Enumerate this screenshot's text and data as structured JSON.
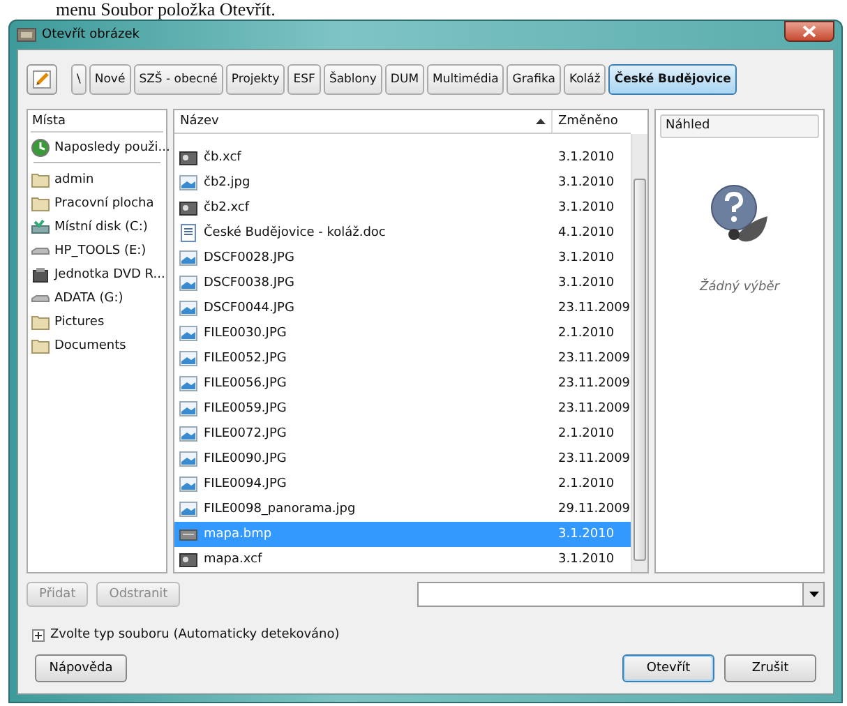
{
  "caption": "menu Soubor položka Otevřít.",
  "window": {
    "title": "Otevřít obrázek"
  },
  "path_bar": [
    {
      "label": "\\",
      "selected": false
    },
    {
      "label": "Nové",
      "selected": false
    },
    {
      "label": "SZŠ - obecné",
      "selected": false
    },
    {
      "label": "Projekty",
      "selected": false
    },
    {
      "label": "ESF",
      "selected": false
    },
    {
      "label": "Šablony",
      "selected": false
    },
    {
      "label": "DUM",
      "selected": false
    },
    {
      "label": "Multimédia",
      "selected": false
    },
    {
      "label": "Grafika",
      "selected": false
    },
    {
      "label": "Koláž",
      "selected": false
    },
    {
      "label": "České Budějovice",
      "selected": true
    }
  ],
  "places": {
    "header": "Místa",
    "items": [
      {
        "label": "Naposledy použi...",
        "kind": "recent",
        "selected": false
      },
      {
        "label": "admin",
        "kind": "folder",
        "selected": false
      },
      {
        "label": "Pracovní plocha",
        "kind": "folder",
        "selected": false
      },
      {
        "label": "Místní disk (C:)",
        "kind": "disk",
        "selected": false
      },
      {
        "label": "HP_TOOLS (E:)",
        "kind": "drive",
        "selected": false
      },
      {
        "label": "Jednotka DVD R...",
        "kind": "dvd",
        "selected": false
      },
      {
        "label": "ADATA (G:)",
        "kind": "drive",
        "selected": false
      },
      {
        "label": "Pictures",
        "kind": "folder",
        "selected": false
      },
      {
        "label": "Documents",
        "kind": "folder",
        "selected": false
      }
    ]
  },
  "files": {
    "columns": [
      "Název",
      "Změněno"
    ],
    "rows": [
      {
        "name": "čb.xcf",
        "modified": "3.1.2010",
        "kind": "xcf",
        "selected": false
      },
      {
        "name": "čb2.jpg",
        "modified": "3.1.2010",
        "kind": "image",
        "selected": false
      },
      {
        "name": "čb2.xcf",
        "modified": "3.1.2010",
        "kind": "xcf",
        "selected": false
      },
      {
        "name": "České Budějovice - koláž.doc",
        "modified": "4.1.2010",
        "kind": "doc",
        "selected": false
      },
      {
        "name": "DSCF0028.JPG",
        "modified": "3.1.2010",
        "kind": "image",
        "selected": false
      },
      {
        "name": "DSCF0038.JPG",
        "modified": "3.1.2010",
        "kind": "image",
        "selected": false
      },
      {
        "name": "DSCF0044.JPG",
        "modified": "23.11.2009",
        "kind": "image",
        "selected": false
      },
      {
        "name": "FILE0030.JPG",
        "modified": "2.1.2010",
        "kind": "image",
        "selected": false
      },
      {
        "name": "FILE0052.JPG",
        "modified": "23.11.2009",
        "kind": "image",
        "selected": false
      },
      {
        "name": "FILE0056.JPG",
        "modified": "23.11.2009",
        "kind": "image",
        "selected": false
      },
      {
        "name": "FILE0059.JPG",
        "modified": "23.11.2009",
        "kind": "image",
        "selected": false
      },
      {
        "name": "FILE0072.JPG",
        "modified": "2.1.2010",
        "kind": "image",
        "selected": false
      },
      {
        "name": "FILE0090.JPG",
        "modified": "23.11.2009",
        "kind": "image",
        "selected": false
      },
      {
        "name": "FILE0094.JPG",
        "modified": "2.1.2010",
        "kind": "image",
        "selected": false
      },
      {
        "name": "FILE0098_panorama.jpg",
        "modified": "29.11.2009",
        "kind": "image",
        "selected": false
      },
      {
        "name": "mapa.bmp",
        "modified": "3.1.2010",
        "kind": "bmp",
        "selected": true
      },
      {
        "name": "mapa.xcf",
        "modified": "3.1.2010",
        "kind": "xcf",
        "selected": false
      }
    ]
  },
  "preview": {
    "header": "Náhled",
    "message": "Žádný výběr"
  },
  "place_buttons": [
    {
      "label": "Přidat",
      "disabled": true
    },
    {
      "label": "Odstranit",
      "disabled": true
    }
  ],
  "file_type": {
    "label": "Zvolte typ souboru (Automaticky detekováno)",
    "expanded": false
  },
  "buttons": [
    {
      "label": "Nápověda",
      "kind": "help",
      "default": false
    },
    {
      "label": "Otevřít",
      "kind": "action",
      "default": true
    },
    {
      "label": "Zrušit",
      "kind": "action",
      "default": false
    }
  ]
}
